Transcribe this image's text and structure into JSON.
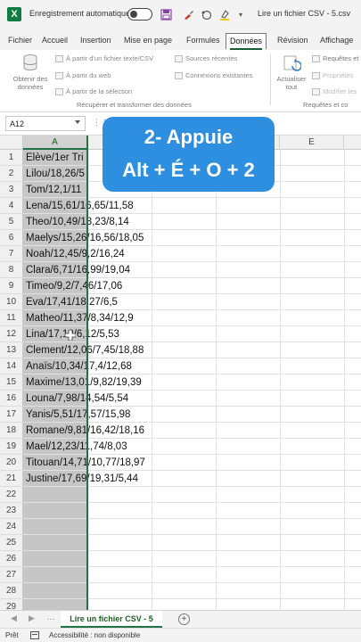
{
  "titlebar": {
    "app_logo": "X",
    "autosave_label": "Enregistrement automatique",
    "doc_title": "Lire un fichier CSV - 5.csv",
    "icons": [
      "save-icon",
      "brush-icon",
      "undo-icon",
      "highlight-icon",
      "dropdown-icon"
    ]
  },
  "tabs": [
    "Fichier",
    "Accueil",
    "Insertion",
    "Mise en page",
    "Formules",
    "Données",
    "Révision",
    "Affichage"
  ],
  "active_tab": "Données",
  "ribbon": {
    "get_data_label_1": "Obtenir des",
    "get_data_label_2": "données",
    "from_text_csv": "À partir d'un fichier texte/CSV",
    "from_web": "À partir du web",
    "from_selection": "À partir de la sélection",
    "recent_sources": "Sources récentes",
    "existing_connections": "Connexions existantes",
    "group_get_transform": "Récupérer et transformer des données",
    "refresh_label_1": "Actualiser",
    "refresh_label_2": "tout",
    "queries": "Requêtes et",
    "properties": "Propriétés",
    "edit_links": "Modifier les",
    "group_queries": "Requêtes et co"
  },
  "formula_bar": {
    "name_box": "A12",
    "fx_separator": "⋮",
    "cancel": "✕"
  },
  "grid": {
    "columns": [
      "A",
      "E"
    ],
    "rows": [
      "1",
      "2",
      "3",
      "4",
      "5",
      "6",
      "7",
      "8",
      "9",
      "10",
      "11",
      "12",
      "13",
      "14",
      "15",
      "16",
      "17",
      "18",
      "19",
      "20",
      "21",
      "22",
      "23",
      "24",
      "25",
      "26",
      "27",
      "28",
      "29"
    ],
    "cells": [
      "Elève/1er Tri",
      "Lilou/18,26/5",
      "Tom/12,1/11",
      "Lena/15,61/16,65/11,58",
      "Theo/10,49/18,23/8,14",
      "Maelys/15,26/16,56/18,05",
      "Noah/12,45/9,2/16,24",
      "Clara/6,71/16,99/19,04",
      "Timeo/9,2/7,46/17,06",
      "Eva/17,41/18,27/6,5",
      "Matheo/11,37/8,34/12,9",
      "Lina/17,18/6,12/5,53",
      "Clement/12,06/7,45/18,88",
      "Anaïs/10,34/17,4/12,68",
      "Maxime/13,01/9,82/19,39",
      "Louna/7,98/14,54/5,54",
      "Yanis/5,51/17,57/15,98",
      "Romane/9,81/16,42/18,16",
      "Mael/12,23/11,74/8,03",
      "Titouan/14,71/10,77/18,97",
      "Justine/17,69/19,31/5,44"
    ],
    "cell_e1_partial": "e"
  },
  "callout": {
    "line1": "2-  Appuie",
    "line2": "Alt + É + O + 2"
  },
  "sheetbar": {
    "prev": "◀",
    "next": "▶",
    "more": "…",
    "active_sheet": "Lire un fichier CSV - 5",
    "add": "+"
  },
  "statusbar": {
    "ready": "Prêt",
    "accessibility": "Accessibilité : non disponible"
  },
  "colors": {
    "excel_green": "#217346",
    "callout_blue": "#2e8ee0",
    "selection_gray": "#c6c6c6"
  }
}
